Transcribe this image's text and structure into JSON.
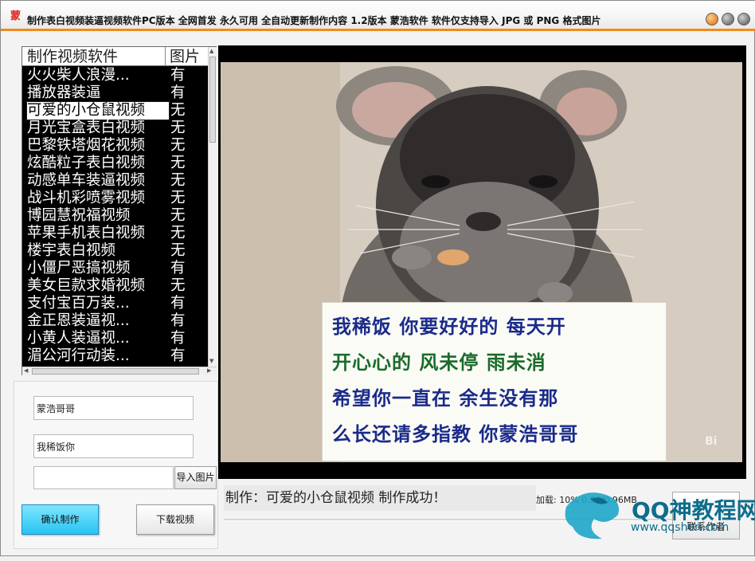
{
  "window": {
    "logo": "蒙",
    "title": "制作表白视频装逼视频软件PC版本 全网首发  永久可用 全自动更新制作内容 1.2版本 蒙浩软件   软件仅支持导入 JPG 或 PNG 格式图片"
  },
  "list": {
    "headers": {
      "name": "制作视频软件",
      "has_image": "图片"
    },
    "rows": [
      {
        "name": "火火柴人浪漫...",
        "has_image": "有"
      },
      {
        "name": "播放器装逼",
        "has_image": "有"
      },
      {
        "name": "可爱的小仓鼠视频",
        "has_image": "无"
      },
      {
        "name": "月光宝盒表白视频",
        "has_image": "无"
      },
      {
        "name": "巴黎铁塔烟花视频",
        "has_image": "无"
      },
      {
        "name": "炫酷粒子表白视频",
        "has_image": "无"
      },
      {
        "name": "动感单车装逼视频",
        "has_image": "无"
      },
      {
        "name": "战斗机彩喷雾视频",
        "has_image": "无"
      },
      {
        "name": "博园慧祝福视频",
        "has_image": "无"
      },
      {
        "name": "苹果手机表白视频",
        "has_image": "无"
      },
      {
        "name": "楼宇表白视频",
        "has_image": "无"
      },
      {
        "name": "小僵尸恶搞视频",
        "has_image": "有"
      },
      {
        "name": "美女巨款求婚视频",
        "has_image": "无"
      },
      {
        "name": "支付宝百万装...",
        "has_image": "有"
      },
      {
        "name": "金正恩装逼视...",
        "has_image": "有"
      },
      {
        "name": "小黄人装逼视...",
        "has_image": "有"
      },
      {
        "name": "湄公河行动装...",
        "has_image": "有"
      }
    ]
  },
  "form": {
    "name_value": "蒙浩哥哥",
    "message_value": "我稀饭你",
    "image_path_value": "",
    "import_label": "导入图片",
    "confirm_label": "确认制作",
    "download_label": "下载视频"
  },
  "preview": {
    "card_lines": [
      "我稀饭 你要好好的 每天开",
      "开心心的 风未停 雨未消",
      "希望你一直在 余生没有那",
      "么长还请多指教 你蒙浩哥哥"
    ],
    "watermark_corner": "Bi"
  },
  "status": {
    "message": "制作：可爱的小仓鼠视频   制作成功！",
    "load_text": "加载: 10%  0.96/0.96MB",
    "right_button_label": "联系作者"
  },
  "overlay_watermark": {
    "title": "QQ神教程网",
    "url": "www.qqshen.com"
  }
}
